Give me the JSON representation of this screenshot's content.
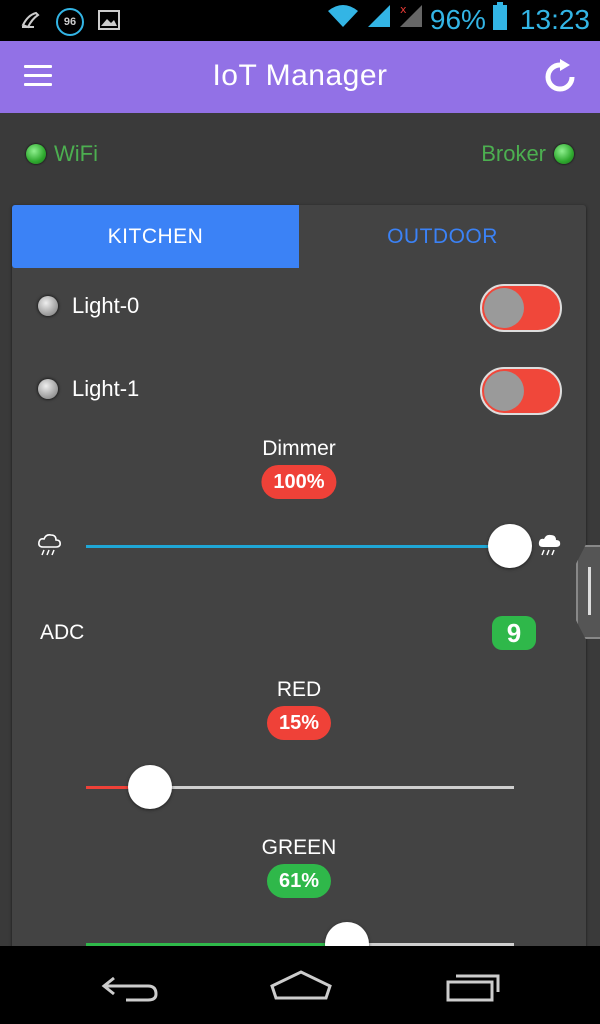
{
  "status_bar": {
    "battery": "96%",
    "time": "13:23",
    "notif_badge": "96",
    "icons": [
      "broom-icon",
      "badge-icon",
      "image-icon",
      "wifi-icon",
      "signal-icon",
      "signal-nosim-icon",
      "battery-icon"
    ]
  },
  "app_bar": {
    "title": "IoT Manager",
    "menu_icon": "menu-icon",
    "refresh_icon": "refresh-icon",
    "color": "#9271e6"
  },
  "connection": {
    "wifi_label": "WiFi",
    "broker_label": "Broker",
    "status_color": "#4caf50"
  },
  "tabs": [
    {
      "label": "KITCHEN",
      "active": true
    },
    {
      "label": "OUTDOOR",
      "active": false
    }
  ],
  "widgets": {
    "light0": {
      "label": "Light-0",
      "state": "off"
    },
    "light1": {
      "label": "Light-1",
      "state": "off"
    },
    "dimmer": {
      "label": "Dimmer",
      "value": "100%",
      "level": 1.0,
      "left_icon": "cloud-rain-outline-icon",
      "right_icon": "cloud-rain-filled-icon"
    },
    "adc": {
      "label": "ADC",
      "value": "9"
    },
    "red": {
      "label": "RED",
      "value": "15%",
      "level": 0.15
    },
    "green": {
      "label": "GREEN",
      "value": "61%",
      "level": 0.61
    }
  },
  "colors": {
    "accent": "#3b82f6",
    "toggle_off": "#f0473a",
    "red": "#ef4138",
    "green": "#2fb84a",
    "dimmer_track": "#1fa7d6"
  },
  "nav_bar": {
    "icons": [
      "back-icon",
      "home-icon",
      "recents-icon"
    ]
  }
}
